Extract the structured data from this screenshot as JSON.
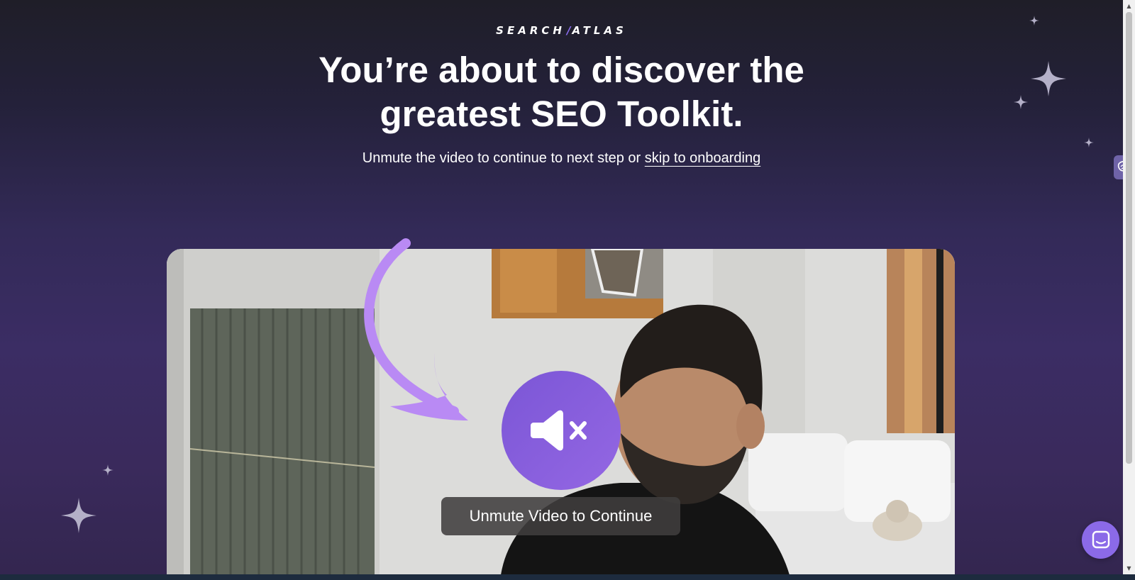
{
  "brand": {
    "logo_left": "SEARCH",
    "logo_slash": "/",
    "logo_right": "ATLAS"
  },
  "hero": {
    "headline_line1": "You’re about to discover the",
    "headline_line2": "greatest SEO Toolkit.",
    "subline_text": "Unmute the video to continue to next step or ",
    "skip_link": "skip to onboarding"
  },
  "video": {
    "muted": true,
    "mute_icon": "volume-muted-icon",
    "unmute_label": "Unmute Video to Continue"
  },
  "widgets": {
    "side_tab_icon": "brain-icon",
    "chat_icon": "chat-bubble-icon"
  },
  "colors": {
    "accent": "#8b6cf0",
    "mute_button": "#8a5fdd",
    "arrow": "#b98af4",
    "background_top": "#1f1e28",
    "background_bottom": "#3a2a5c"
  }
}
